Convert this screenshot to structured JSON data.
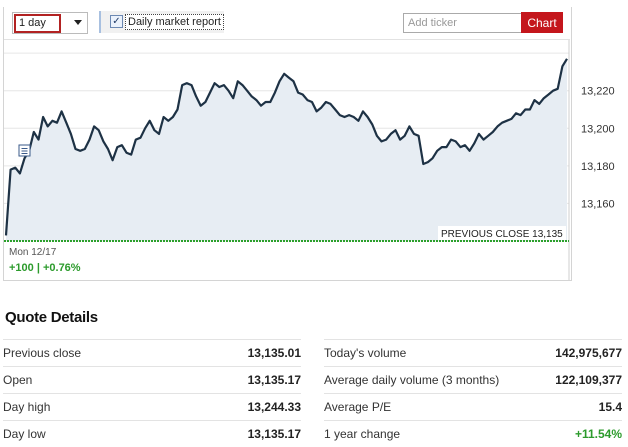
{
  "toolbar": {
    "period_selected": "1 day",
    "report_checkbox_mark": "✓",
    "report_label": "Daily market report",
    "ticker_placeholder": "Add ticker",
    "chart_button": "Chart"
  },
  "chart_data": {
    "type": "area",
    "y_ticks": [
      "13,220",
      "13,200",
      "13,180",
      "13,160"
    ],
    "ylim": [
      13140,
      13247
    ],
    "previous_close_label": "PREVIOUS CLOSE 13,135",
    "previous_close": 13135,
    "date_label": "Mon 12/17",
    "change_label": "+100 | +0.76%",
    "colors": {
      "line": "#1e3245",
      "fill": "#e7edf3",
      "baseline": "#2ca02c",
      "grid": "#e6e6e6"
    },
    "series": [
      {
        "values": [
          13143,
          13178,
          13179,
          13176,
          13184,
          13188,
          13198,
          13194,
          13206,
          13201,
          13204,
          13203,
          13209,
          13203,
          13197,
          13189,
          13188,
          13189,
          13194,
          13201,
          13199,
          13193,
          13189,
          13183,
          13190,
          13191,
          13187,
          13186,
          13194,
          13195,
          13200,
          13204,
          13199,
          13197,
          13206,
          13204,
          13206,
          13210,
          13223,
          13224,
          13223,
          13217,
          13212,
          13214,
          13219,
          13224,
          13222,
          13223,
          13220,
          13216,
          13225,
          13223,
          13220,
          13217,
          13215,
          13212,
          13214,
          13214,
          13219,
          13225,
          13229,
          13227,
          13225,
          13219,
          13218,
          13215,
          13214,
          13209,
          13211,
          13214,
          13213,
          13210,
          13207,
          13206,
          13207,
          13206,
          13204,
          13209,
          13206,
          13202,
          13196,
          13193,
          13194,
          13197,
          13199,
          13194,
          13196,
          13201,
          13197,
          13196,
          13181,
          13182,
          13184,
          13188,
          13190,
          13190,
          13194,
          13193,
          13190,
          13191,
          13188,
          13192,
          13197,
          13194,
          13196,
          13198,
          13201,
          13203,
          13204,
          13205,
          13208,
          13207,
          13210,
          13210,
          13215,
          13213,
          13216,
          13218,
          13220,
          13221,
          13233,
          13237
        ]
      }
    ]
  },
  "quote": {
    "title": "Quote Details",
    "left": [
      {
        "label": "Previous close",
        "value": "13,135.01"
      },
      {
        "label": "Open",
        "value": "13,135.17"
      },
      {
        "label": "Day high",
        "value": "13,244.33"
      },
      {
        "label": "Day low",
        "value": "13,135.17"
      }
    ],
    "right": [
      {
        "label": "Today's volume",
        "value": "142,975,677"
      },
      {
        "label": "Average daily volume (3 months)",
        "value": "122,109,377"
      },
      {
        "label": "Average P/E",
        "value": "15.4"
      },
      {
        "label": "1 year change",
        "value": "+11.54%",
        "positive": true
      }
    ]
  }
}
